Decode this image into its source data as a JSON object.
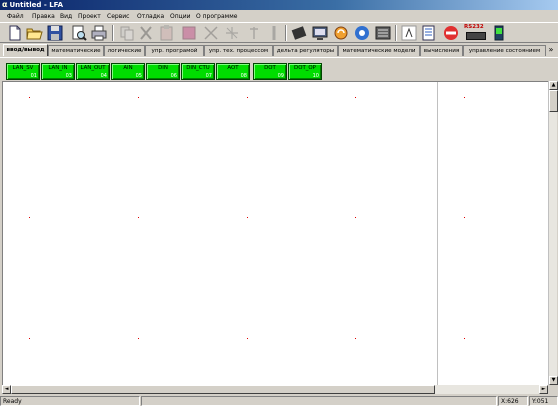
{
  "window": {
    "title": "Untitled - LFA",
    "logo": "α"
  },
  "menu": [
    "Файл",
    "Правка",
    "Вид",
    "Проект",
    "Сервис",
    "Отладка",
    "Опции",
    "О программе"
  ],
  "toolbar": {
    "icons": [
      "new-file-icon",
      "open-folder-icon",
      "save-disk-icon",
      "print-preview-icon",
      "print-icon",
      "copy-icon",
      "cut-icon",
      "paste-icon",
      "delete-icon",
      "line-tool-icon",
      "scissors-icon",
      "pin-icon",
      "wire-icon",
      "chip-icon",
      "monitor-icon",
      "refresh-icon",
      "gear-icon",
      "document-icon",
      "globe-icon",
      "notes-icon",
      "no-entry-icon",
      "rs232-icon",
      "battery-icon"
    ],
    "rs232_label": "RS232"
  },
  "tabs": [
    "ввод/вывод",
    "математические",
    "логические",
    "упр. програмой",
    "упр. тех. процессом",
    "дельта регуляторы",
    "математические модели",
    "вычисления",
    "управление состоянием"
  ],
  "tabs_more": "»",
  "palette": [
    {
      "name": "LAN_SV",
      "num": "01"
    },
    {
      "name": "LAN_IN",
      "num": "03"
    },
    {
      "name": "LAN_OUT",
      "num": "04"
    },
    {
      "name": "AIN",
      "num": "05"
    },
    {
      "name": "DIN",
      "num": "06"
    },
    {
      "name": "DIN_CTU",
      "num": "07"
    },
    {
      "name": "AOT",
      "num": "08"
    },
    {
      "name": "DOT",
      "num": "09"
    },
    {
      "name": "DOT_OP",
      "num": "10"
    }
  ],
  "scroll": {
    "up": "▲",
    "down": "▼",
    "left": "◄",
    "right": "►"
  },
  "status": {
    "text": "Ready",
    "x": "X:626",
    "y": "Y:051"
  }
}
